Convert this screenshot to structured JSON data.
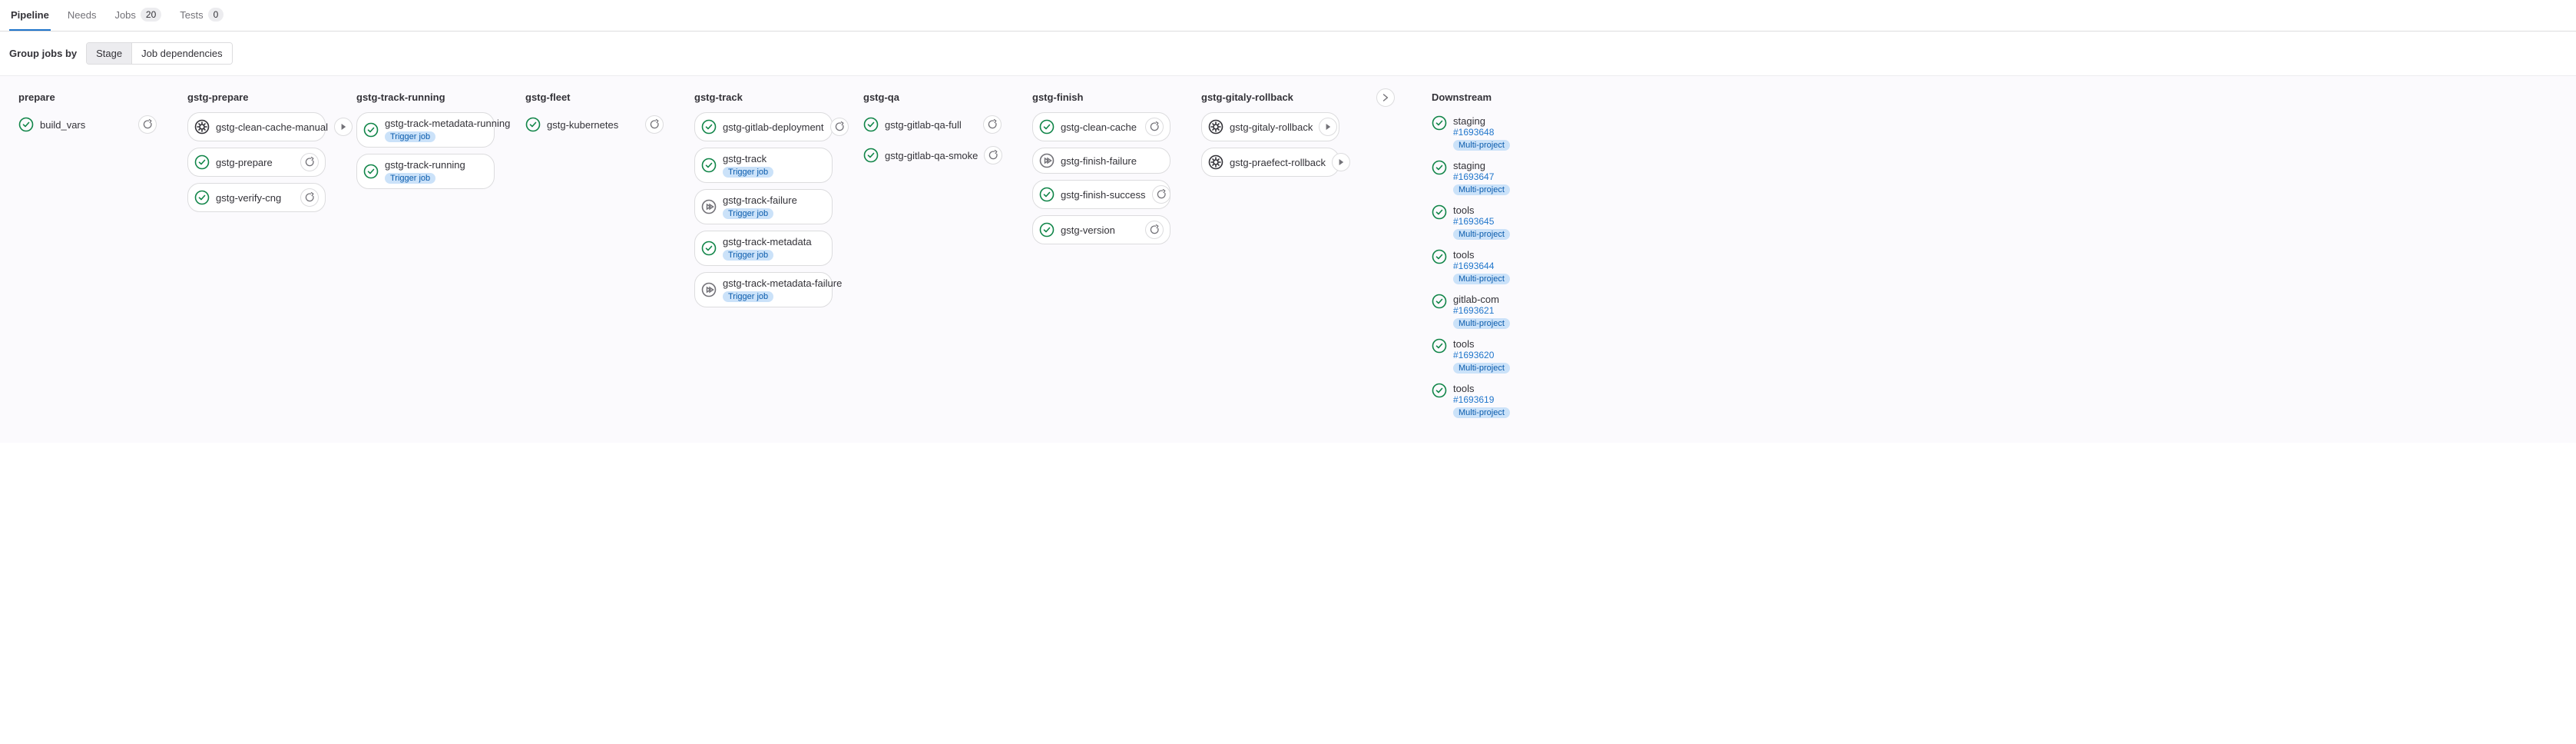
{
  "tabs": {
    "pipeline": "Pipeline",
    "needs": "Needs",
    "jobs": "Jobs",
    "jobs_count": "20",
    "tests": "Tests",
    "tests_count": "0"
  },
  "toolbar": {
    "group_label": "Group jobs by",
    "stage": "Stage",
    "deps": "Job dependencies"
  },
  "trigger_label": "Trigger job",
  "multi_label": "Multi-project",
  "stages": {
    "prepare": {
      "title": "prepare",
      "jobs": [
        {
          "name": "build_vars",
          "status": "passed",
          "action": "retry",
          "bare": true
        }
      ]
    },
    "gstg_prepare": {
      "title": "gstg-prepare",
      "jobs": [
        {
          "name": "gstg-clean-cache-manual",
          "status": "manual",
          "action": "play"
        },
        {
          "name": "gstg-prepare",
          "status": "passed",
          "action": "retry"
        },
        {
          "name": "gstg-verify-cng",
          "status": "passed",
          "action": "retry"
        }
      ]
    },
    "gstg_track_running": {
      "title": "gstg-track-running",
      "jobs": [
        {
          "name": "gstg-track-metadata-running",
          "status": "passed",
          "trigger": true
        },
        {
          "name": "gstg-track-running",
          "status": "passed",
          "trigger": true
        }
      ]
    },
    "gstg_fleet": {
      "title": "gstg-fleet",
      "jobs": [
        {
          "name": "gstg-kubernetes",
          "status": "passed",
          "action": "retry",
          "bare": true
        }
      ]
    },
    "gstg_track": {
      "title": "gstg-track",
      "jobs": [
        {
          "name": "gstg-gitlab-deployment",
          "status": "passed",
          "action": "retry"
        },
        {
          "name": "gstg-track",
          "status": "passed",
          "trigger": true
        },
        {
          "name": "gstg-track-failure",
          "status": "skipped",
          "trigger": true
        },
        {
          "name": "gstg-track-metadata",
          "status": "passed",
          "trigger": true
        },
        {
          "name": "gstg-track-metadata-failure",
          "status": "skipped",
          "trigger": true
        }
      ]
    },
    "gstg_qa": {
      "title": "gstg-qa",
      "jobs": [
        {
          "name": "gstg-gitlab-qa-full",
          "status": "passed",
          "action": "retry",
          "bare": true
        },
        {
          "name": "gstg-gitlab-qa-smoke",
          "status": "passed",
          "action": "retry",
          "bare": true
        }
      ]
    },
    "gstg_finish": {
      "title": "gstg-finish",
      "jobs": [
        {
          "name": "gstg-clean-cache",
          "status": "passed",
          "action": "retry"
        },
        {
          "name": "gstg-finish-failure",
          "status": "skipped"
        },
        {
          "name": "gstg-finish-success",
          "status": "passed",
          "action": "retry"
        },
        {
          "name": "gstg-version",
          "status": "passed",
          "action": "retry"
        }
      ]
    },
    "gstg_gitaly_rollback": {
      "title": "gstg-gitaly-rollback",
      "expand": true,
      "jobs": [
        {
          "name": "gstg-gitaly-rollback",
          "status": "manual",
          "action": "play"
        },
        {
          "name": "gstg-praefect-rollback",
          "status": "manual",
          "action": "play"
        }
      ]
    }
  },
  "downstream": {
    "title": "Downstream",
    "items": [
      {
        "name": "staging",
        "id": "#1693648",
        "status": "passed",
        "multi": true
      },
      {
        "name": "staging",
        "id": "#1693647",
        "status": "passed",
        "multi": true
      },
      {
        "name": "tools",
        "id": "#1693645",
        "status": "passed",
        "multi": true
      },
      {
        "name": "tools",
        "id": "#1693644",
        "status": "passed",
        "multi": true
      },
      {
        "name": "gitlab-com",
        "id": "#1693621",
        "status": "passed",
        "multi": true
      },
      {
        "name": "tools",
        "id": "#1693620",
        "status": "passed",
        "multi": true
      },
      {
        "name": "tools",
        "id": "#1693619",
        "status": "passed",
        "multi": true
      }
    ]
  }
}
